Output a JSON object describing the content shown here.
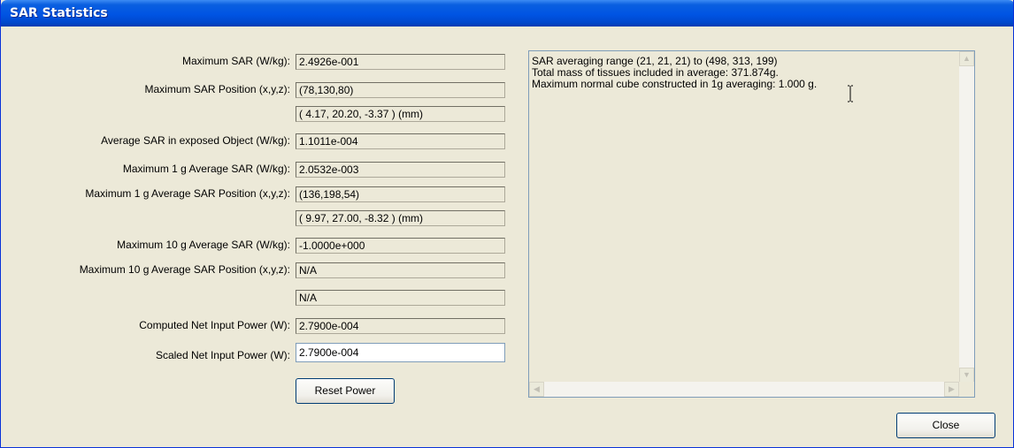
{
  "window": {
    "title": "SAR Statistics"
  },
  "stats": [
    {
      "label": "Maximum SAR (W/kg):",
      "value": "2.4926e-001"
    },
    {
      "label": "Maximum SAR Position (x,y,z):",
      "value": "(78,130,80)"
    },
    {
      "label": "",
      "value": "( 4.17, 20.20, -3.37 ) (mm)"
    },
    {
      "label": "Average SAR in exposed Object (W/kg):",
      "value": "1.1011e-004"
    },
    {
      "label": "Maximum 1 g  Average SAR (W/kg):",
      "value": "2.0532e-003"
    },
    {
      "label": "Maximum 1 g Average SAR Position (x,y,z):",
      "value": "(136,198,54)"
    },
    {
      "label": "",
      "value": "( 9.97, 27.00, -8.32 ) (mm)"
    },
    {
      "label": "Maximum 10 g Average SAR (W/kg):",
      "value": "-1.0000e+000"
    },
    {
      "label": "Maximum 10 g  Average SAR Position (x,y,z):",
      "value": "N/A"
    },
    {
      "label": "",
      "value": "N/A"
    },
    {
      "label": "Computed Net Input Power (W):",
      "value": "2.7900e-004"
    }
  ],
  "scaled_power": {
    "label": "Scaled Net Input Power (W):",
    "value": "2.7900e-004"
  },
  "buttons": {
    "reset": "Reset Power",
    "close": "Close"
  },
  "log": {
    "lines": [
      "SAR averaging range (21, 21, 21) to (498, 313, 199)",
      "Total mass of tissues included in average: 371.874g.",
      "Maximum normal cube constructed in 1g averaging: 1.000  g."
    ]
  },
  "icons": {
    "scroll_up": "scroll-up-arrow",
    "scroll_down": "scroll-down-arrow",
    "scroll_left": "scroll-left-arrow",
    "scroll_right": "scroll-right-arrow",
    "cursor": "text-ibeam-cursor"
  }
}
